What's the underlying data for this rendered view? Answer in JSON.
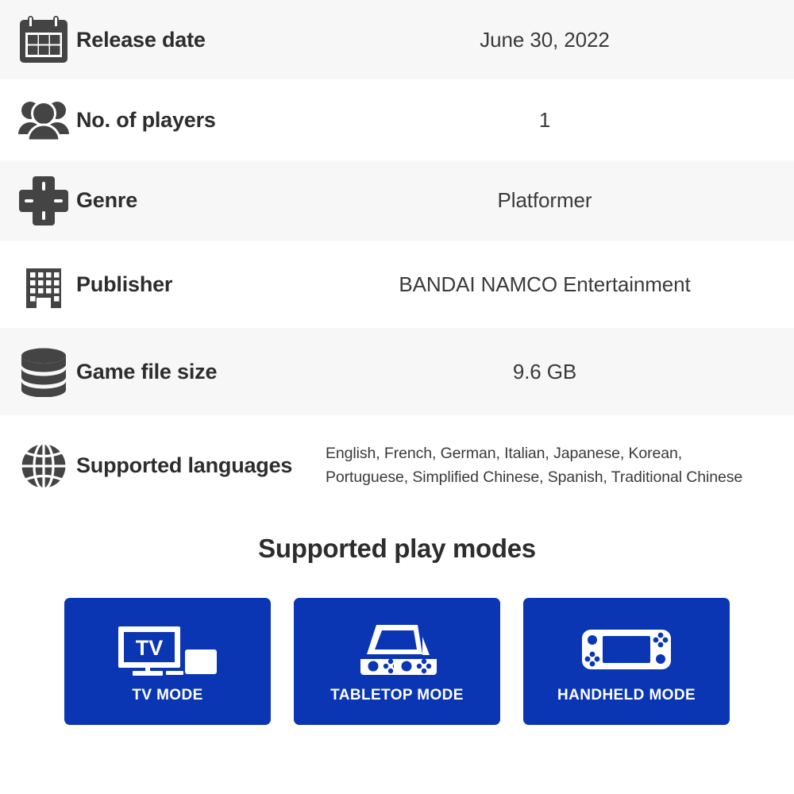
{
  "specs": [
    {
      "icon": "calendar-icon",
      "label": "Release date",
      "value": "June 30, 2022"
    },
    {
      "icon": "players-icon",
      "label": "No. of players",
      "value": "1"
    },
    {
      "icon": "dpad-icon",
      "label": "Genre",
      "value": "Platformer"
    },
    {
      "icon": "building-icon",
      "label": "Publisher",
      "value": "BANDAI NAMCO Entertainment"
    },
    {
      "icon": "database-icon",
      "label": "Game file size",
      "value": "9.6 GB"
    },
    {
      "icon": "globe-icon",
      "label": "Supported languages",
      "value": "English, French, German, Italian, Japanese, Korean, Portuguese, Simplified Chinese, Spanish, Traditional Chinese"
    }
  ],
  "play_modes": {
    "title": "Supported play modes",
    "cards": [
      {
        "icon": "tv-mode-icon",
        "label": "TV MODE",
        "screen_text": "TV"
      },
      {
        "icon": "tabletop-mode-icon",
        "label": "TABLETOP MODE"
      },
      {
        "icon": "handheld-mode-icon",
        "label": "HANDHELD MODE"
      }
    ]
  },
  "colors": {
    "accent_blue": "#0a36b4",
    "row_alt_background": "#f7f7f7",
    "row_background": "#ffffff",
    "label_text": "#2d2d2d",
    "value_text": "#3a3a3a",
    "icon_fill": "#444444"
  }
}
